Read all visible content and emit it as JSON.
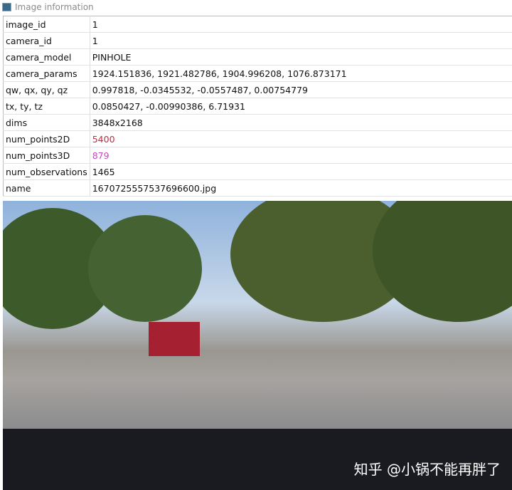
{
  "window": {
    "title": "Image information"
  },
  "rows": [
    {
      "key": "image_id",
      "value": "1"
    },
    {
      "key": "camera_id",
      "value": "1"
    },
    {
      "key": "camera_model",
      "value": "PINHOLE"
    },
    {
      "key": "camera_params",
      "value": "1924.151836, 1921.482786, 1904.996208, 1076.873171"
    },
    {
      "key": "qw, qx, qy, qz",
      "value": "0.997818, -0.0345532, -0.0557487, 0.00754779"
    },
    {
      "key": "tx, ty, tz",
      "value": "0.0850427, -0.00990386, 6.71931"
    },
    {
      "key": "dims",
      "value": "3848x2168"
    },
    {
      "key": "num_points2D",
      "value": "5400",
      "color": "#d0243a"
    },
    {
      "key": "num_points3D",
      "value": "879",
      "color": "#d040c8"
    },
    {
      "key": "num_observations",
      "value": "1465"
    },
    {
      "key": "name",
      "value": "1670725557537696600.jpg"
    }
  ],
  "watermark": "知乎 @小锅不能再胖了"
}
